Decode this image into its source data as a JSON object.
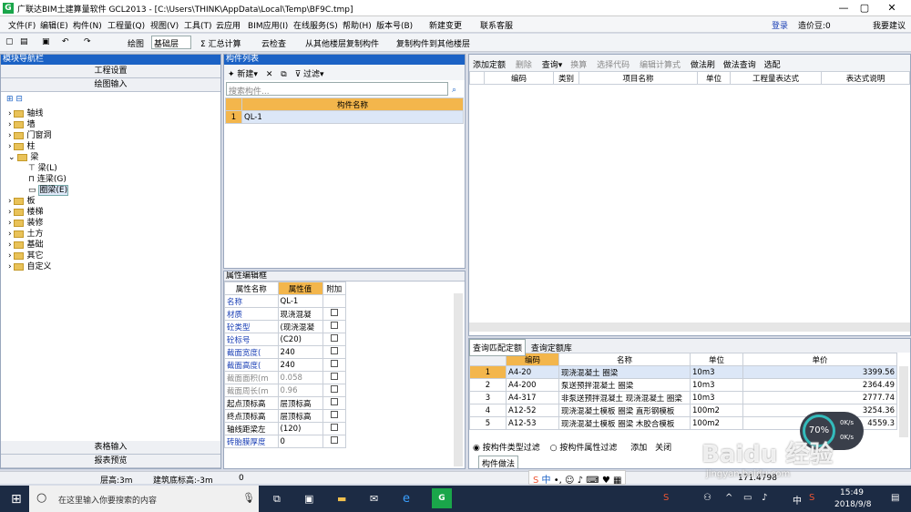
{
  "titlebar": {
    "app_title": "广联达BIM土建算量软件 GCL2013 - [C:\\Users\\THINK\\AppData\\Local\\Temp\\BF9C.tmp]",
    "min": "—",
    "max": "▢",
    "close": "✕"
  },
  "menus": [
    "文件(F)",
    "编辑(E)",
    "构件(N)",
    "工程量(Q)",
    "视图(V)",
    "工具(T)",
    "云应用",
    "BIM应用(I)",
    "在线服务(S)",
    "帮助(H)",
    "版本号(B)",
    "新建变更",
    "联系客服"
  ],
  "account": {
    "login": "登录",
    "price_bean": "造价豆:0",
    "suggest": "我要建议"
  },
  "toolbar": {
    "draw": "绘图",
    "layer": "基础层",
    "sum": "汇总计算",
    "cloud_check": "云检查",
    "copy_from": "从其他楼层复制构件",
    "copy_to": "复制构件到其他楼层"
  },
  "nav": {
    "title": "模块导航栏",
    "project_settings": "工程设置",
    "drawing_input": "绘图输入",
    "table_input": "表格输入",
    "report_preview": "报表预览",
    "tree": [
      "轴线",
      "墙",
      "门窗洞",
      "柱",
      "梁",
      "板",
      "楼梯",
      "装修",
      "土方",
      "基础",
      "其它",
      "自定义"
    ],
    "beam_children": [
      "梁(L)",
      "连梁(G)",
      "圈梁(E)"
    ]
  },
  "comp_list": {
    "title": "构件列表",
    "new": "新建",
    "filter": "过滤",
    "search_placeholder": "搜索构件...",
    "col_name": "构件名称",
    "rows": [
      {
        "idx": "1",
        "name": "QL-1"
      }
    ]
  },
  "props": {
    "title": "属性编辑框",
    "headers": [
      "属性名称",
      "属性值",
      "附加"
    ],
    "rows": [
      {
        "name": "名称",
        "value": "QL-1"
      },
      {
        "name": "材质",
        "value": "现浇混凝"
      },
      {
        "name": "砼类型",
        "value": "(现浇混凝"
      },
      {
        "name": "砼标号",
        "value": "(C20)"
      },
      {
        "name": "截面宽度(",
        "value": "240"
      },
      {
        "name": "截面高度(",
        "value": "240"
      },
      {
        "name": "截面面积(m",
        "value": "0.058"
      },
      {
        "name": "截面周长(m",
        "value": "0.96"
      },
      {
        "name": "起点顶标高",
        "value": "层顶标高"
      },
      {
        "name": "终点顶标高",
        "value": "层顶标高"
      },
      {
        "name": "轴线距梁左",
        "value": "(120)"
      },
      {
        "name": "砖胎膜厚度",
        "value": "0"
      }
    ]
  },
  "quota": {
    "add": "添加定额",
    "delete": "删除",
    "query": "查询",
    "convert": "换算",
    "select_code": "选择代码",
    "edit_formula": "编辑计算式",
    "method_brush": "做法刷",
    "method_query": "做法查询",
    "select_match": "选配",
    "headers": [
      "编码",
      "类别",
      "项目名称",
      "单位",
      "工程量表达式",
      "表达式说明"
    ]
  },
  "lib": {
    "tab1": "查询匹配定额",
    "tab2": "查询定额库",
    "headers": [
      "编码",
      "名称",
      "单位",
      "单价"
    ],
    "rows": [
      {
        "idx": "1",
        "code": "A4-20",
        "name": "现浇混凝土 圈梁",
        "unit": "10m3",
        "price": "3399.56"
      },
      {
        "idx": "2",
        "code": "A4-200",
        "name": "泵送预拌混凝土 圈梁",
        "unit": "10m3",
        "price": "2364.49"
      },
      {
        "idx": "3",
        "code": "A4-317",
        "name": "非泵送预拌混凝土 现浇混凝土 圈梁",
        "unit": "10m3",
        "price": "2777.74"
      },
      {
        "idx": "4",
        "code": "A12-52",
        "name": "现浇混凝土模板 圈梁 直形钢模板",
        "unit": "100m2",
        "price": "3254.36"
      },
      {
        "idx": "5",
        "code": "A12-53",
        "name": "现浇混凝土模板 圈梁 木胶合模板",
        "unit": "100m2",
        "price": "4559.3"
      }
    ],
    "radio1": "按构件类型过滤",
    "radio2": "按构件属性过滤",
    "add": "添加",
    "close": "关闭",
    "method_tab": "构件做法"
  },
  "status": {
    "floor_height": "层高:3m",
    "elev": "建筑底标高:-3m",
    "zero": "0",
    "coords": "171.4798"
  },
  "taskbar": {
    "search": "在这里输入你要搜索的内容",
    "time": "15:49",
    "date": "2018/9/8",
    "ime": "中",
    "net_pct": "70%",
    "up": "0K/s",
    "down": "0K/s"
  },
  "watermark": {
    "text": "Baidu 经验",
    "url": "jingyan.baidu.com"
  },
  "colors": {
    "accent": "#1b62c5",
    "header": "#f3b64c",
    "taskbar": "#1c2b44"
  }
}
